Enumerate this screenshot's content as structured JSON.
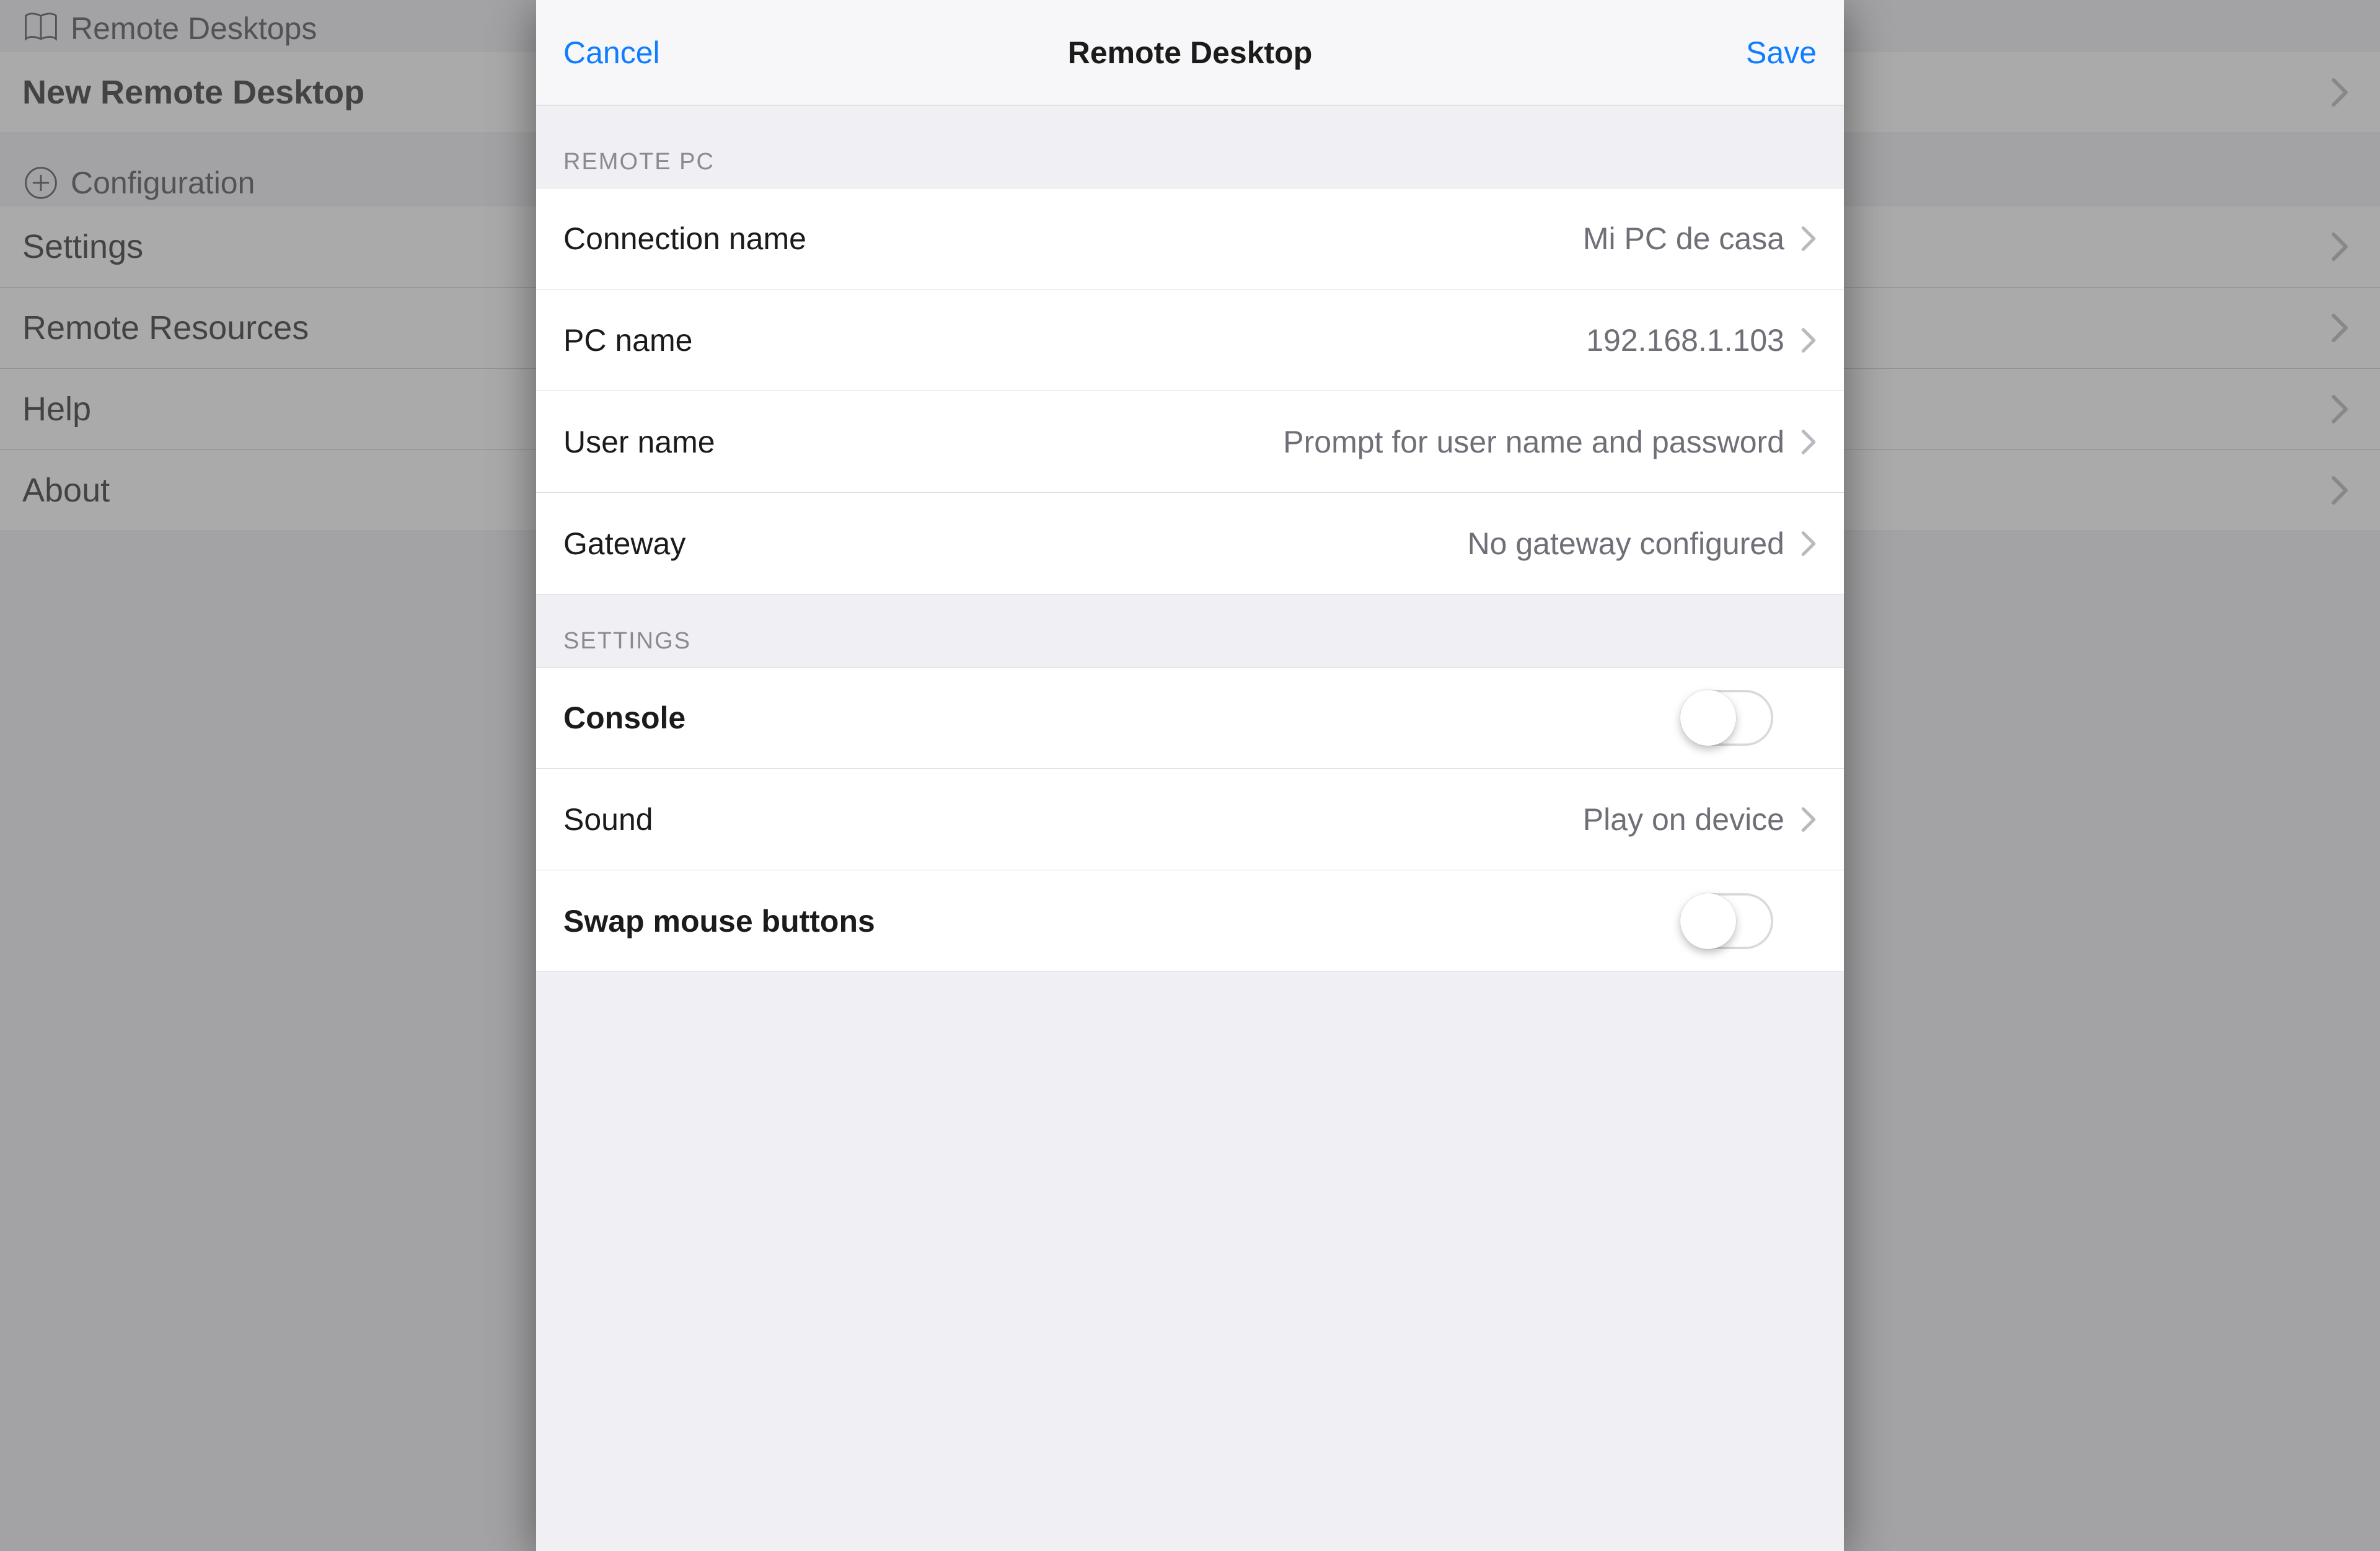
{
  "background": {
    "section_remote_label": "Remote Desktops",
    "row_new_remote": "New Remote Desktop",
    "section_config_label": "Configuration",
    "rows": {
      "settings": "Settings",
      "remote_resources": "Remote Resources",
      "help": "Help",
      "about": "About"
    }
  },
  "modal": {
    "cancel": "Cancel",
    "title": "Remote Desktop",
    "save": "Save",
    "group_remote_pc": "REMOTE PC",
    "group_settings": "SETTINGS",
    "remote_pc": {
      "connection_name_label": "Connection name",
      "connection_name_value": "Mi PC de casa",
      "pc_name_label": "PC name",
      "pc_name_value": "192.168.1.103",
      "user_name_label": "User name",
      "user_name_value": "Prompt for user name and password",
      "gateway_label": "Gateway",
      "gateway_value": "No gateway configured"
    },
    "settings": {
      "console_label": "Console",
      "sound_label": "Sound",
      "sound_value": "Play on device",
      "swap_label": "Swap mouse buttons"
    }
  }
}
